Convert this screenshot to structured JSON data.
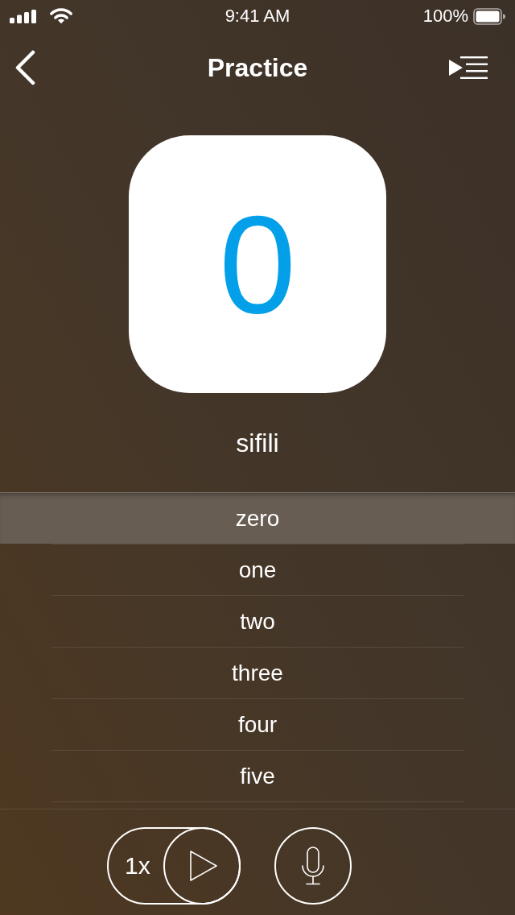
{
  "status_bar": {
    "time": "9:41 AM",
    "battery": "100%"
  },
  "nav": {
    "title": "Practice"
  },
  "card": {
    "numeral": "0"
  },
  "word": "sifili",
  "options": [
    {
      "label": "zero",
      "selected": true
    },
    {
      "label": "one",
      "selected": false
    },
    {
      "label": "two",
      "selected": false
    },
    {
      "label": "three",
      "selected": false
    },
    {
      "label": "four",
      "selected": false
    },
    {
      "label": "five",
      "selected": false
    }
  ],
  "controls": {
    "speed": "1x"
  }
}
